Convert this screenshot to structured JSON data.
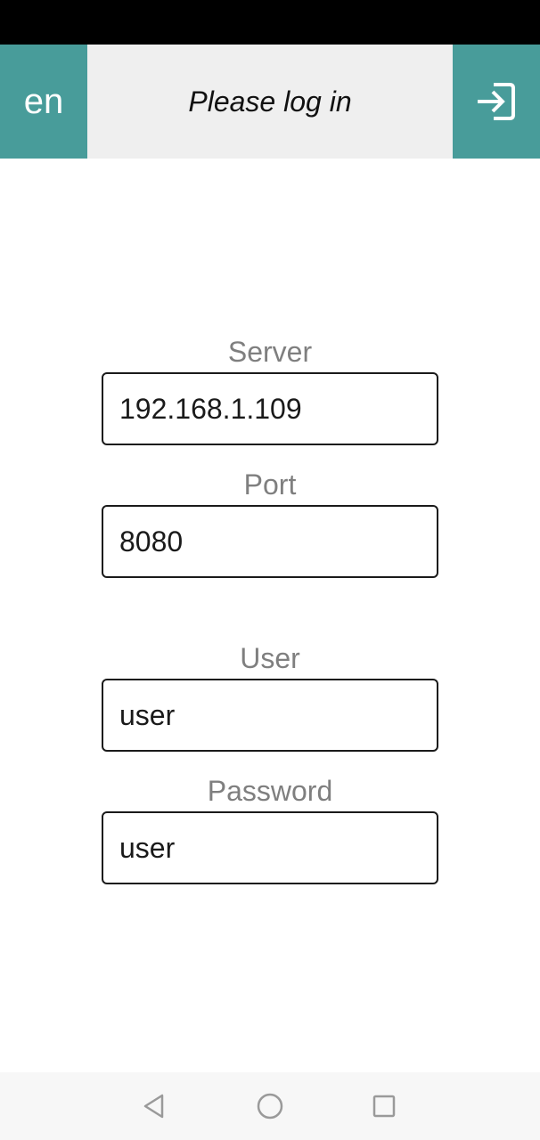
{
  "header": {
    "language_label": "en",
    "title": "Please log in",
    "login_icon": "login-arrow-icon",
    "accent_color": "#489c9a"
  },
  "form": {
    "server": {
      "label": "Server",
      "value": "192.168.1.109"
    },
    "port": {
      "label": "Port",
      "value": "8080"
    },
    "user": {
      "label": "User",
      "value": "user"
    },
    "password": {
      "label": "Password",
      "value": "user"
    }
  },
  "nav_bar": {
    "back_icon": "back-triangle-icon",
    "home_icon": "home-circle-icon",
    "recents_icon": "recents-square-icon"
  }
}
